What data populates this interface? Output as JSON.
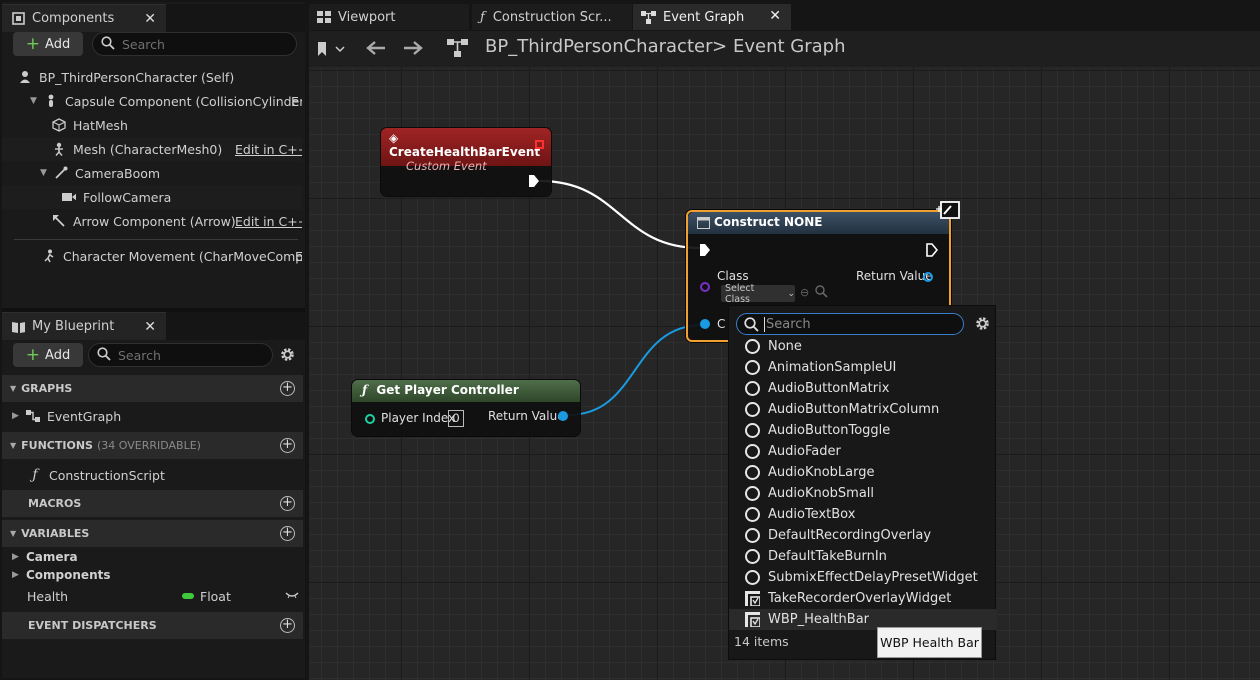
{
  "components_panel": {
    "title": "Components",
    "add_label": "Add",
    "search_placeholder": "Search",
    "tree": [
      {
        "label": "BP_ThirdPersonCharacter (Self)"
      },
      {
        "label": "Capsule Component (CollisionCylinder)",
        "trailing": "E"
      },
      {
        "label": "HatMesh"
      },
      {
        "label": "Mesh (CharacterMesh0)",
        "edit": "Edit in C++"
      },
      {
        "label": "CameraBoom"
      },
      {
        "label": "FollowCamera"
      },
      {
        "label": "Arrow Component (Arrow)",
        "edit": "Edit in C++"
      },
      {
        "label": "Character Movement (CharMoveComp)",
        "trailing": "E"
      }
    ]
  },
  "blueprint_panel": {
    "title": "My Blueprint",
    "add_label": "Add",
    "search_placeholder": "Search",
    "graphs_header": "GRAPHS",
    "graph_item": "EventGraph",
    "functions_header": "FUNCTIONS",
    "functions_sub": "(34 OVERRIDABLE)",
    "function_item": "ConstructionScript",
    "macros_header": "MACROS",
    "variables_header": "VARIABLES",
    "var_categories": [
      "Camera",
      "Components"
    ],
    "variable": {
      "name": "Health",
      "type": "Float",
      "type_color": "#3ec83a"
    },
    "dispatchers_header": "EVENT DISPATCHERS"
  },
  "tabs": [
    {
      "label": "Viewport",
      "icon": "viewport-icon"
    },
    {
      "label": "Construction Scr...",
      "icon": "function-icon"
    },
    {
      "label": "Event Graph",
      "icon": "graph-icon"
    }
  ],
  "breadcrumb": {
    "root": "BP_ThirdPersonCharacter",
    "separator": ">",
    "current": "Event Graph"
  },
  "nodes": {
    "custom_event": {
      "title": "CreateHealthBarEvent",
      "subtitle": "Custom Event",
      "header_color": "#8e1c1c"
    },
    "construct": {
      "title": "Construct NONE",
      "class_label": "Class",
      "select_class": "Select Class",
      "return_label": "Return Value",
      "owner_initial": "C"
    },
    "get_pc": {
      "title": "Get Player Controller",
      "index_label": "Player Index",
      "index_value": "0",
      "return_label": "Return Value"
    }
  },
  "class_picker": {
    "search_placeholder": "Search",
    "items": [
      {
        "label": "None",
        "kind": "class"
      },
      {
        "label": "AnimationSampleUI",
        "kind": "class"
      },
      {
        "label": "AudioButtonMatrix",
        "kind": "class"
      },
      {
        "label": "AudioButtonMatrixColumn",
        "kind": "class"
      },
      {
        "label": "AudioButtonToggle",
        "kind": "class"
      },
      {
        "label": "AudioFader",
        "kind": "class"
      },
      {
        "label": "AudioKnobLarge",
        "kind": "class"
      },
      {
        "label": "AudioKnobSmall",
        "kind": "class"
      },
      {
        "label": "AudioTextBox",
        "kind": "class"
      },
      {
        "label": "DefaultRecordingOverlay",
        "kind": "class"
      },
      {
        "label": "DefaultTakeBurnIn",
        "kind": "class"
      },
      {
        "label": "SubmixEffectDelayPresetWidget",
        "kind": "class"
      },
      {
        "label": "TakeRecorderOverlayWidget",
        "kind": "widget-blueprint"
      },
      {
        "label": "WBP_HealthBar",
        "kind": "widget-blueprint"
      }
    ],
    "count": "14 items",
    "tooltip": "WBP Health Bar"
  }
}
